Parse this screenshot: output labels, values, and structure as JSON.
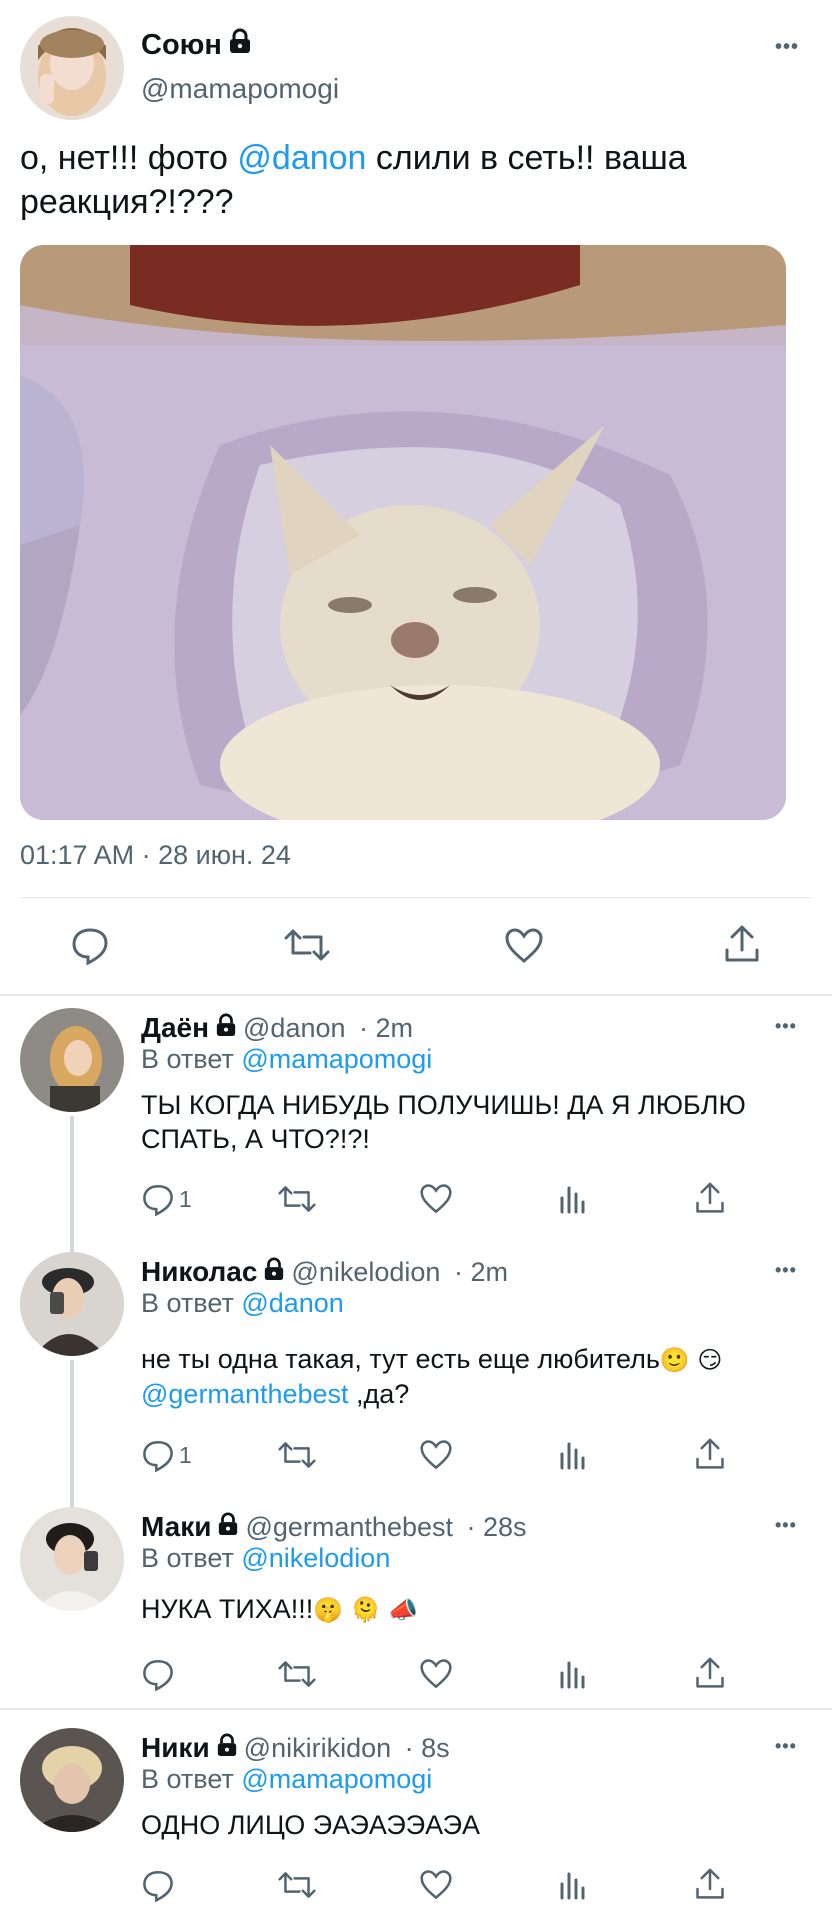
{
  "main_tweet": {
    "author_name": "Союн",
    "author_handle": "@mamapomogi",
    "text_before": "о, нет!!! фото ",
    "mention": "@danon",
    "text_after": " слили в сеть!! ваша реакция?!???",
    "timestamp": "01:17 AM · 28 июн. 24",
    "actions": [
      "comment-icon",
      "retweet-icon",
      "like-icon",
      "share-icon"
    ]
  },
  "replies": [
    {
      "name": "Даён",
      "handle": "@danon",
      "age": "2m",
      "reply_label": "В ответ ",
      "reply_to": "@mamapomogi",
      "text": "ТЫ КОГДА НИБУДЬ ПОЛУЧИШЬ! ДА Я ЛЮБЛЮ СПАТЬ, А ЧТО?!?!",
      "comment_count": "1"
    },
    {
      "name": "Николас",
      "handle": "@nikelodion",
      "age": "2m",
      "reply_label": "В ответ ",
      "reply_to": "@danon",
      "text": "не ты одна такая, тут есть еще любитель",
      "text_emoji": "🙂 😏",
      "mention": "@germanthebest",
      "text_after": " ,да?",
      "comment_count": "1"
    },
    {
      "name": "Маки",
      "handle": "@germanthebest",
      "age": "28s",
      "reply_label": "В ответ ",
      "reply_to": "@nikelodion",
      "text": "НУКА ТИХА!!!",
      "text_emoji": "🤫 🫠 📣",
      "comment_count": ""
    },
    {
      "name": "Ники",
      "handle": "@nikirikidon",
      "age": "8s",
      "reply_label": "В ответ ",
      "reply_to": "@mamapomogi",
      "text": "ОДНО ЛИЦО ЭАЭАЭЭАЭА",
      "comment_count": ""
    }
  ],
  "more_label": "•••",
  "colors": {
    "link": "#1d9bf0",
    "secondary": "#536471",
    "divider": "#e6e8eb"
  }
}
